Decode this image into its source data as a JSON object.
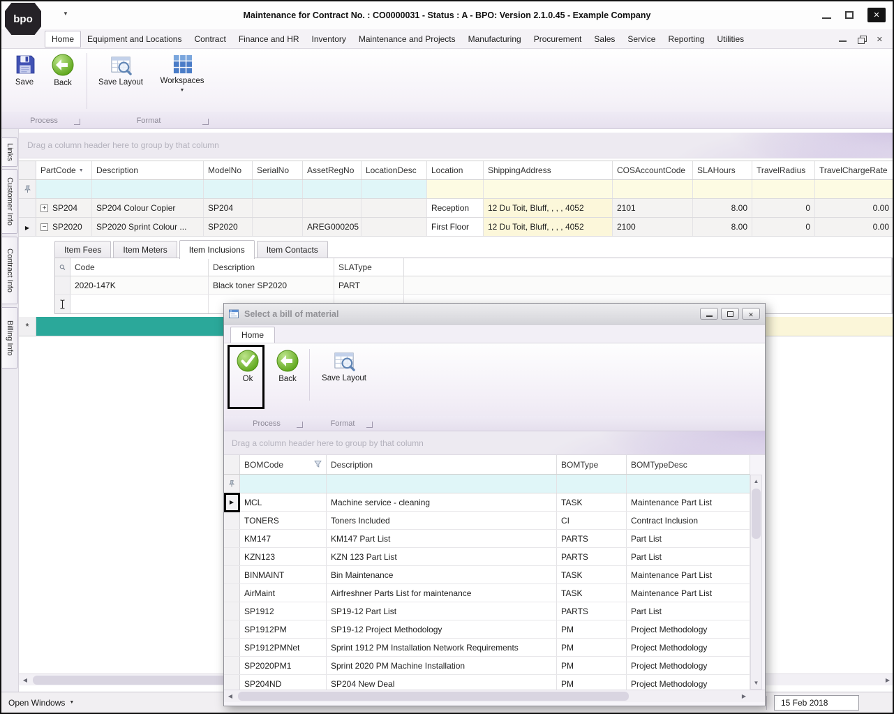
{
  "window": {
    "logo_text": "bpo",
    "title": "Maintenance for Contract No. : CO0000031 - Status : A - BPO: Version 2.1.0.45 - Example Company"
  },
  "menu": {
    "tabs": [
      "Home",
      "Equipment and Locations",
      "Contract",
      "Finance and HR",
      "Inventory",
      "Maintenance and Projects",
      "Manufacturing",
      "Procurement",
      "Sales",
      "Service",
      "Reporting",
      "Utilities"
    ],
    "active_tab": "Home"
  },
  "ribbon": {
    "save": "Save",
    "back": "Back",
    "save_layout": "Save Layout",
    "workspaces": "Workspaces",
    "process_group": "Process",
    "format_group": "Format"
  },
  "sidebar": {
    "tabs": [
      "Links",
      "Customer Info",
      "Contract Info",
      "Billing Info"
    ]
  },
  "grid": {
    "drag_hint": "Drag a column header here to group by that column",
    "columns": [
      "PartCode",
      "Description",
      "ModelNo",
      "SerialNo",
      "AssetRegNo",
      "LocationDesc",
      "Location",
      "ShippingAddress",
      "COSAccountCode",
      "SLAHours",
      "TravelRadius",
      "TravelChargeRate"
    ],
    "rows": [
      {
        "partcode": "SP204",
        "description": "SP204 Colour Copier",
        "modelno": "SP204",
        "serialno": "",
        "assetregno": "",
        "locationdesc": "",
        "location": "Reception",
        "shippingaddress": "12 Du Toit, Bluff, , , , 4052",
        "cosaccountcode": "2101",
        "slahours": "8.00",
        "travelradius": "0",
        "travelchargerate": "0.00"
      },
      {
        "partcode": "SP2020",
        "description": "SP2020 Sprint Colour ...",
        "modelno": "SP2020",
        "serialno": "",
        "assetregno": "AREG000205",
        "locationdesc": "",
        "location": "First Floor",
        "shippingaddress": "12 Du Toit, Bluff, , , , 4052",
        "cosaccountcode": "2100",
        "slahours": "8.00",
        "travelradius": "0",
        "travelchargerate": "0.00"
      }
    ],
    "new_row_indicator": "*"
  },
  "detail": {
    "tabs": [
      "Item Fees",
      "Item Meters",
      "Item Inclusions",
      "Item Contacts"
    ],
    "active_tab": "Item Inclusions",
    "columns": [
      "Code",
      "Description",
      "SLAType"
    ],
    "rows": [
      {
        "code": "2020-147K",
        "description": "Black toner SP2020",
        "slatype": "PART"
      }
    ]
  },
  "dialog": {
    "title": "Select a bill of material",
    "tab": "Home",
    "ok": "Ok",
    "back": "Back",
    "save_layout": "Save Layout",
    "process_group": "Process",
    "format_group": "Format",
    "drag_hint": "Drag a column header here to group by that column",
    "columns": [
      "BOMCode",
      "Description",
      "BOMType",
      "BOMTypeDesc"
    ],
    "rows": [
      {
        "bomcode": "MCL",
        "description": "Machine service - cleaning",
        "bomtype": "TASK",
        "bomtypedesc": "Maintenance Part List"
      },
      {
        "bomcode": "TONERS",
        "description": "Toners Included",
        "bomtype": "CI",
        "bomtypedesc": "Contract Inclusion"
      },
      {
        "bomcode": "KM147",
        "description": "KM147 Part List",
        "bomtype": "PARTS",
        "bomtypedesc": "Part List"
      },
      {
        "bomcode": "KZN123",
        "description": "KZN 123 Part List",
        "bomtype": "PARTS",
        "bomtypedesc": "Part List"
      },
      {
        "bomcode": "BINMAINT",
        "description": "Bin Maintenance",
        "bomtype": "TASK",
        "bomtypedesc": "Maintenance Part List"
      },
      {
        "bomcode": "AirMaint",
        "description": "Airfreshner Parts List for maintenance",
        "bomtype": "TASK",
        "bomtypedesc": "Maintenance Part List"
      },
      {
        "bomcode": "SP1912",
        "description": "SP19-12 Part List",
        "bomtype": "PARTS",
        "bomtypedesc": "Part List"
      },
      {
        "bomcode": "SP1912PM",
        "description": "SP19-12 Project Methodology",
        "bomtype": "PM",
        "bomtypedesc": "Project Methodology"
      },
      {
        "bomcode": "SP1912PMNet",
        "description": "Sprint 1912 PM Installation Network Requirements",
        "bomtype": "PM",
        "bomtypedesc": "Project Methodology"
      },
      {
        "bomcode": "SP2020PM1",
        "description": "Sprint 2020 PM Machine Installation",
        "bomtype": "PM",
        "bomtypedesc": "Project Methodology"
      },
      {
        "bomcode": "SP204ND",
        "description": "SP204 New Deal",
        "bomtype": "PM",
        "bomtypedesc": "Project Methodology"
      }
    ]
  },
  "statusbar": {
    "open_windows": "Open Windows",
    "date": "15 Feb 2018"
  },
  "colors": {
    "accent_teal": "#2BA89A",
    "filter_cyan": "#E0F6F8",
    "editable_yellow": "#FCF7DA",
    "annotation": "#000000"
  }
}
